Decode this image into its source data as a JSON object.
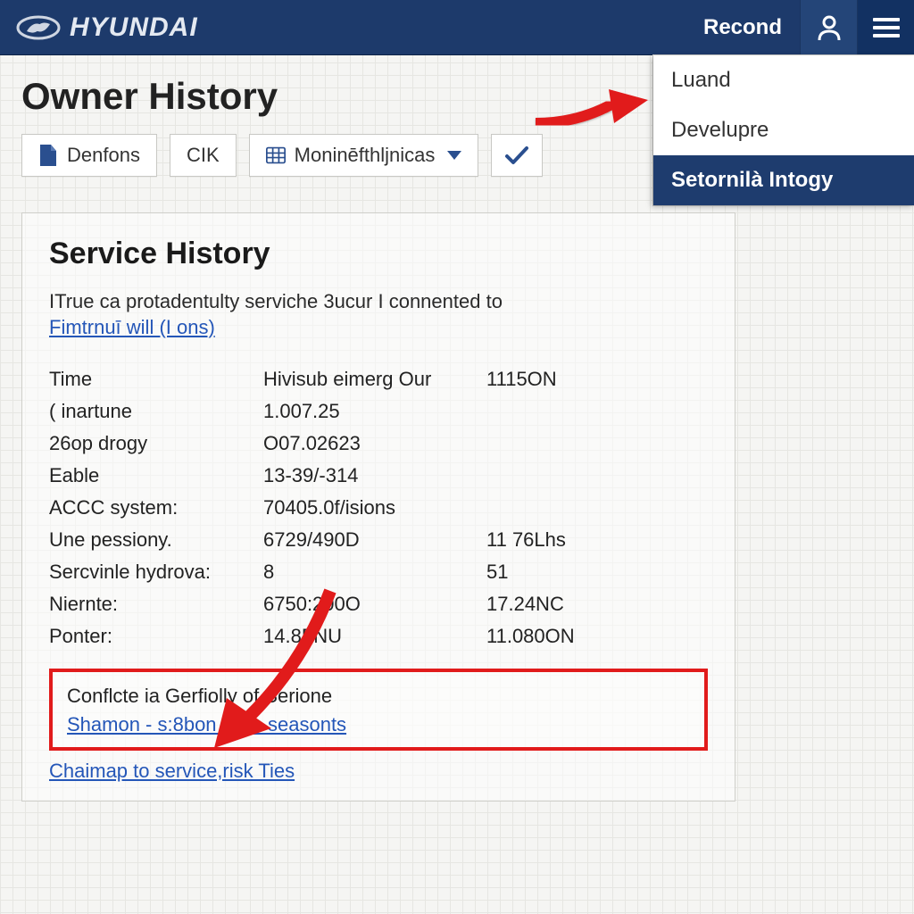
{
  "header": {
    "brand": "HYUNDAI",
    "recond_label": "Recond"
  },
  "dropdown": {
    "items": [
      {
        "label": "Luand"
      },
      {
        "label": "Develupre"
      },
      {
        "label": "Setornilà Intogy",
        "selected": true
      }
    ]
  },
  "page_title": "Owner History",
  "toolbar": {
    "denfons_label": "Denfons",
    "cik_label": "CIK",
    "monin_label": "Moninēfthljnicas"
  },
  "panel": {
    "title": "Service History",
    "intro_text": "ITrue ca protadentulty serviche 3ucur I connented to",
    "intro_link": "Fimtrnuī will (I ons)",
    "rows": [
      {
        "c1": "Time",
        "c2": "Hivisub eimerg Our",
        "c3": "1115ON"
      },
      {
        "c1": "( inartune",
        "c2": "1.007.25",
        "c3": ""
      },
      {
        "c1": "26op drogy",
        "c2": "O07.02623",
        "c3": ""
      },
      {
        "c1": "Eable",
        "c2": "13-39/-314",
        "c3": ""
      },
      {
        "c1": "ACCC system:",
        "c2": "70405.0f/isions",
        "c3": ""
      },
      {
        "c1": "Une pessiony.",
        "c2": "6729/490D",
        "c3": "11 76Lhs"
      },
      {
        "c1": "Sercvinle hydrova:",
        "c2": "8",
        "c3": "51"
      },
      {
        "c1": "Niernte:",
        "c2": "6750:200O",
        "c3": "17.24NC"
      },
      {
        "c1": "Ponter:",
        "c2": "14.8FNU",
        "c3": "11.080ON"
      }
    ],
    "highlight": {
      "line1": "Conflcte ia Gerfiolly of Serione",
      "line2": "Shamon - s:8bon our - seasonts"
    },
    "bottom_link": "Chaimap to service,risk Ties"
  },
  "colors": {
    "header_bg": "#1d3a6b",
    "accent_red": "#e11b1b",
    "link_blue": "#2456b8"
  }
}
